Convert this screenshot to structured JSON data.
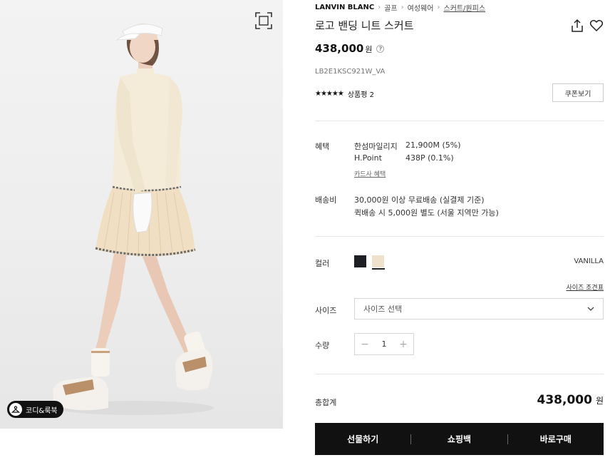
{
  "gallery": {
    "lookbook_label": "코디&룩북",
    "icons": {
      "zoom": "fullscreen-icon",
      "lookbook": "hanger-icon"
    }
  },
  "breadcrumb": [
    "LANVIN BLANC",
    "골프",
    "여성웨어",
    "스커트/원피스"
  ],
  "product": {
    "title": "로고 밴딩 니트 스커트",
    "price": "438,000",
    "price_unit": "원",
    "price_help": "?",
    "sku": "LB2E1KSC921W_VA",
    "stars": "★★★★★",
    "review_label": "상품평 2",
    "coupon_label": "쿠폰보기"
  },
  "benefits": {
    "label": "혜택",
    "rows": [
      {
        "name": "한섬마일리지",
        "value": "21,900M (5%)"
      },
      {
        "name": "H.Point",
        "value": "438P (0.1%)"
      }
    ],
    "card_link": "카드사 혜택"
  },
  "shipping": {
    "label": "배송비",
    "line1": "30,000원 이상 무료배송 (실결제 기준)",
    "line2": "퀵배송 시 5,000원 별도 (서울 지역만 가능)"
  },
  "color": {
    "label": "컬러",
    "selected": "VANILLA",
    "swatches": [
      {
        "name": "black",
        "hex": "#1d1f24"
      },
      {
        "name": "vanilla",
        "hex": "#efe2cc"
      }
    ],
    "size_chart_link": "사이즈 조견표"
  },
  "size": {
    "label": "사이즈",
    "placeholder": "사이즈 선택"
  },
  "quantity": {
    "label": "수량",
    "value": "1",
    "minus": "−",
    "plus": "+"
  },
  "total": {
    "label": "총합계",
    "value": "438,000",
    "unit": "원"
  },
  "actions": {
    "gift": "선물하기",
    "cart": "쇼핑백",
    "buy": "바로구매"
  }
}
